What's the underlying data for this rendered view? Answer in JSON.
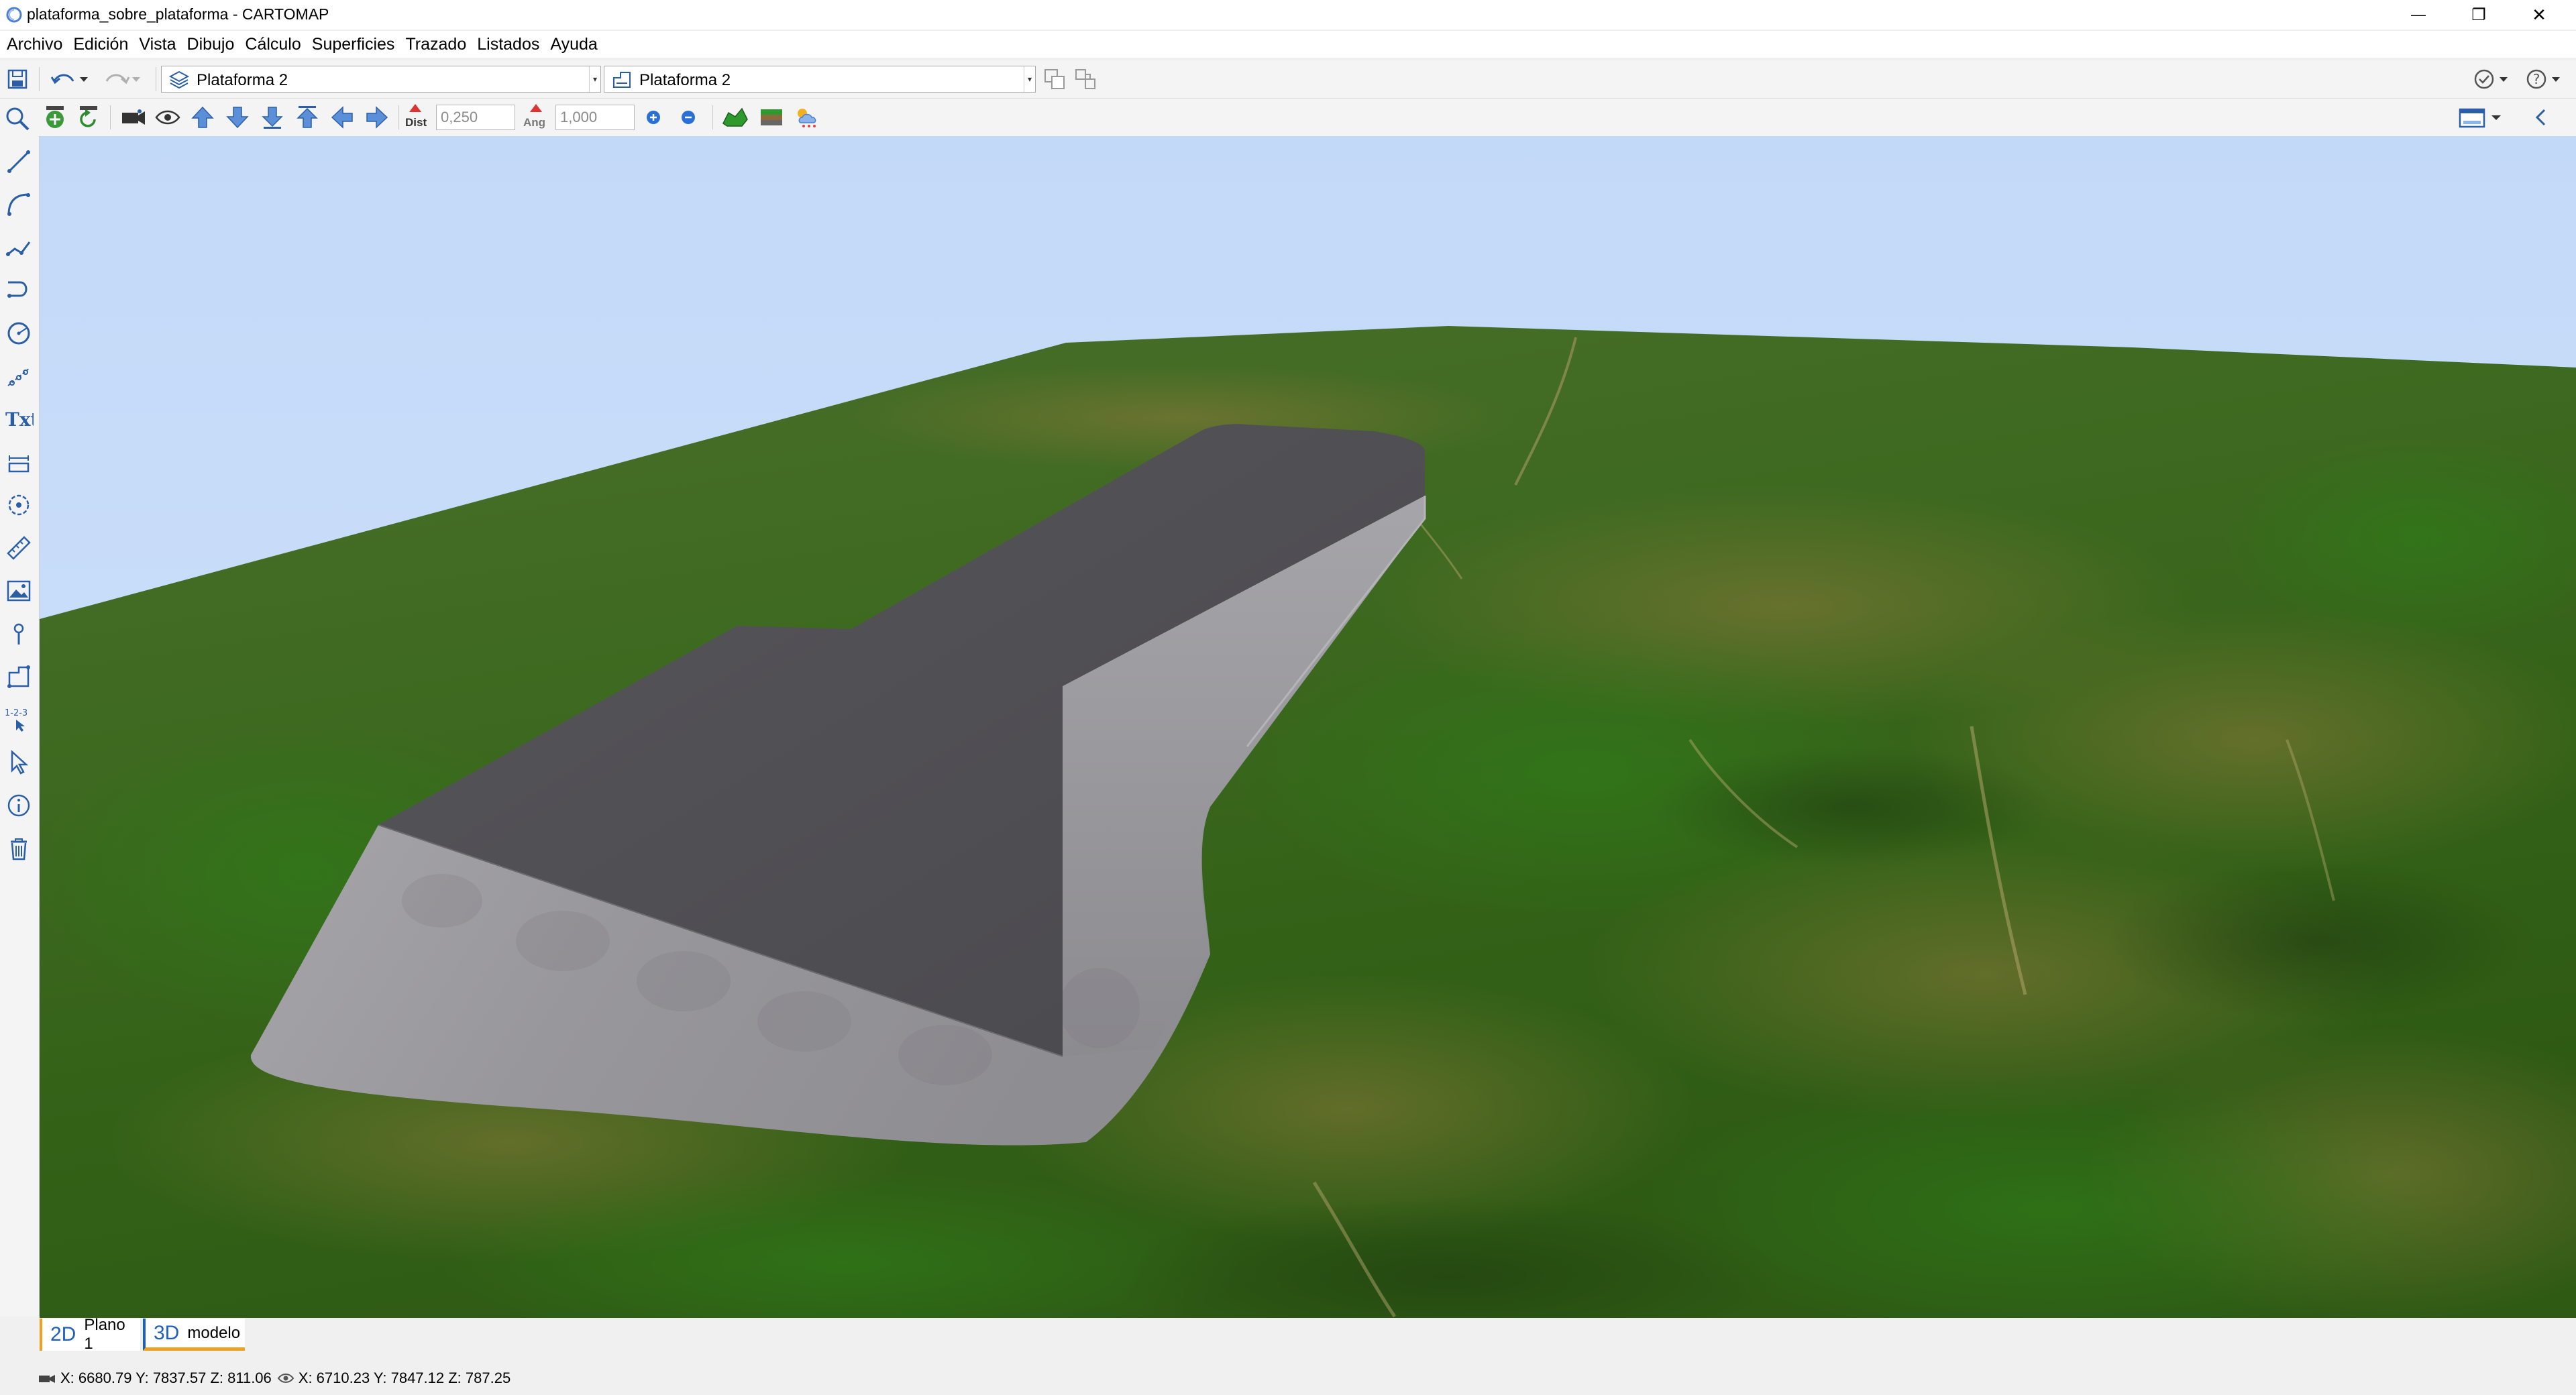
{
  "window": {
    "title": "plataforma_sobre_plataforma - CARTOMAP",
    "minimize": "—",
    "restore": "❐",
    "close": "✕"
  },
  "menu": [
    {
      "label": "Archivo"
    },
    {
      "label": "Edición"
    },
    {
      "label": "Vista"
    },
    {
      "label": "Dibujo"
    },
    {
      "label": "Cálculo"
    },
    {
      "label": "Superficies"
    },
    {
      "label": "Trazado"
    },
    {
      "label": "Listados"
    },
    {
      "label": "Ayuda"
    }
  ],
  "toolbar1": {
    "layer_combo": "Plataforma 2",
    "platform_combo": "Plataforma 2"
  },
  "toolbar2": {
    "dist_label": "Dist",
    "dist_value": "0,250",
    "ang_label": "Ang",
    "ang_value": "1,000"
  },
  "tabs": [
    {
      "prefix": "2D",
      "label": "Plano 1"
    },
    {
      "prefix": "3D",
      "label": "modelo"
    }
  ],
  "status": {
    "camera_coords": "X: 6680.79   Y: 7837.57   Z: 811.06",
    "target_coords": "X: 6710.23   Y: 7847.12   Z: 787.25"
  },
  "colors": {
    "accent_2d": "#f0a020",
    "accent_3d": "#1f5fbf",
    "sky": "#c7dcf8",
    "terrain": "#3c6a22",
    "platform_top": "#4d4c51",
    "embankment": "#9c9b9f"
  },
  "icons": {
    "save": "floppy-icon",
    "undo": "undo-icon",
    "redo": "redo-icon",
    "zoom": "magnifier-icon"
  }
}
